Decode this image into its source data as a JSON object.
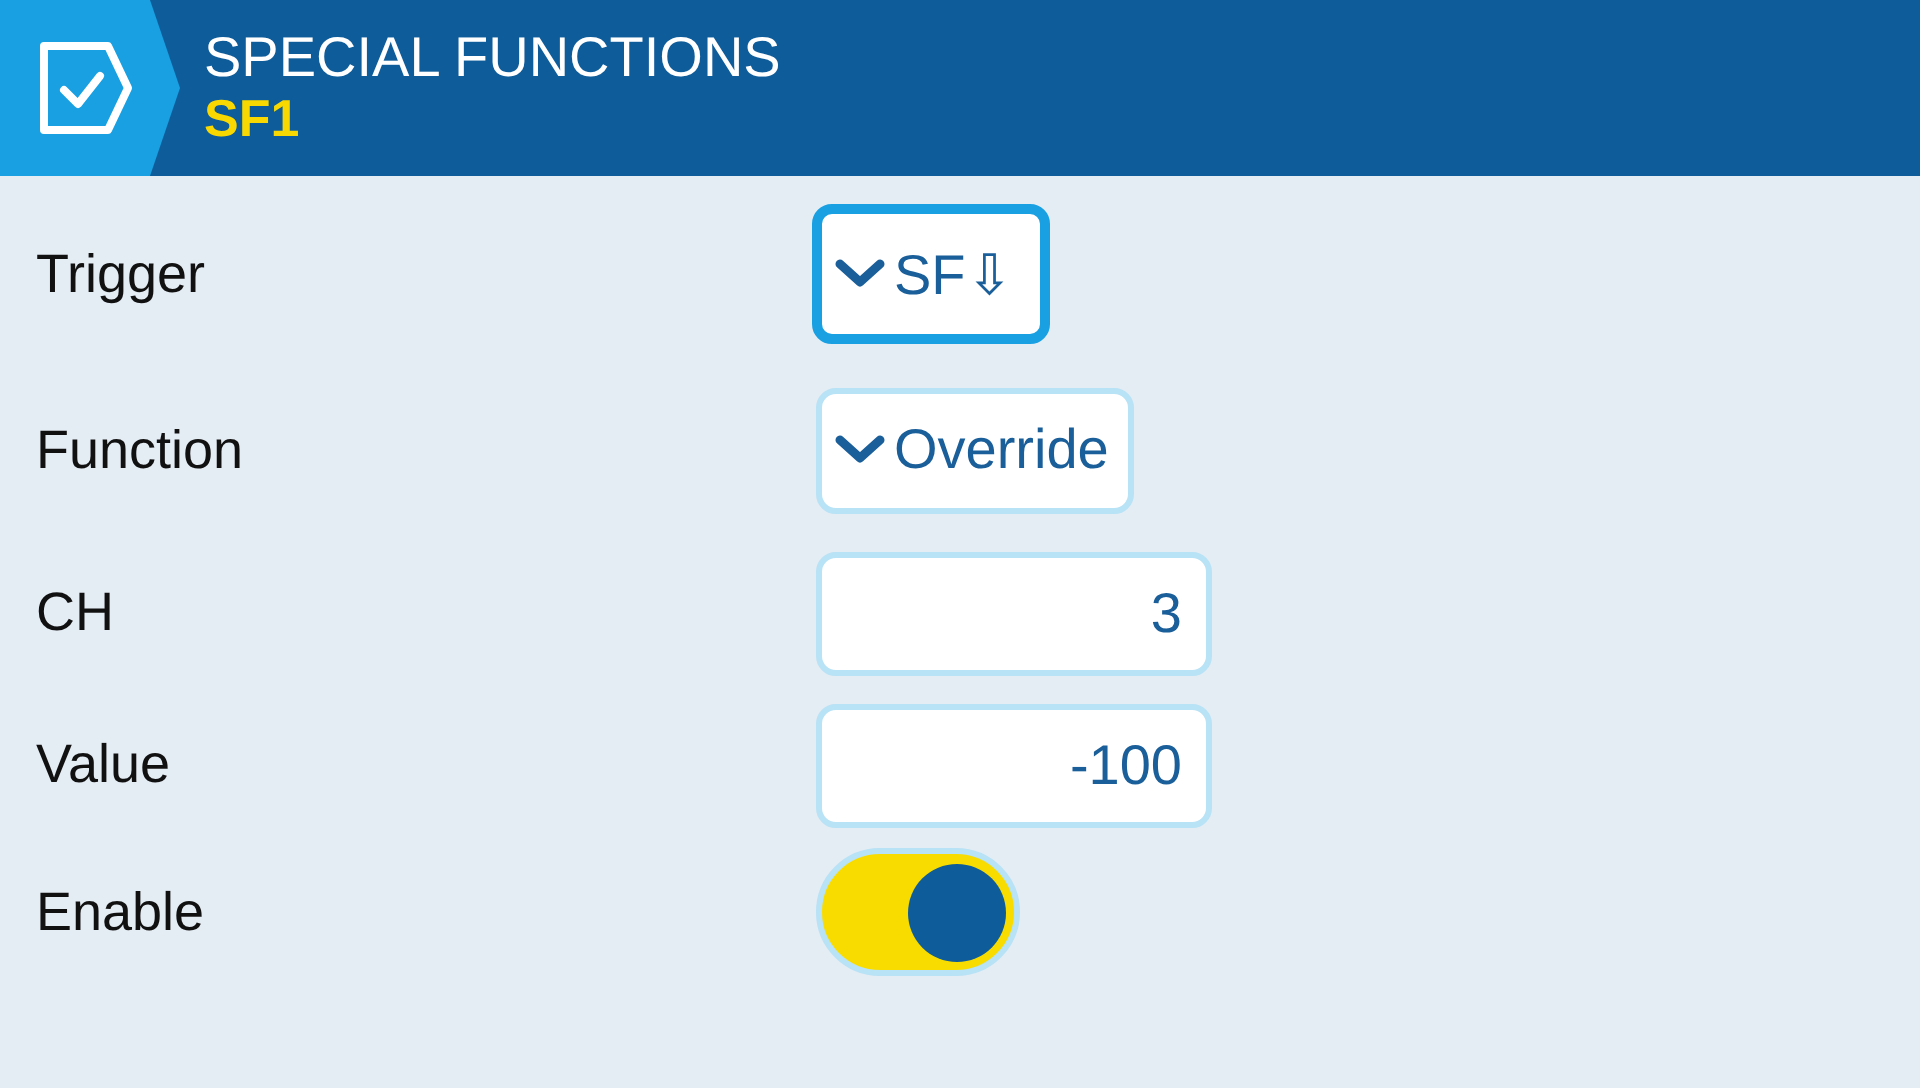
{
  "header": {
    "title": "SPECIAL FUNCTIONS",
    "subtitle": "SF1"
  },
  "rows": [
    {
      "label": "Trigger",
      "kind": "dropdown",
      "value": "SF⇩",
      "focused": true
    },
    {
      "label": "Function",
      "kind": "dropdown",
      "value": "Override",
      "focused": false
    },
    {
      "label": "CH",
      "kind": "number",
      "value": "3",
      "focused": false
    },
    {
      "label": "Value",
      "kind": "number",
      "value": "-100",
      "focused": false
    },
    {
      "label": "Enable",
      "kind": "toggle",
      "on": true,
      "focused": false
    }
  ]
}
